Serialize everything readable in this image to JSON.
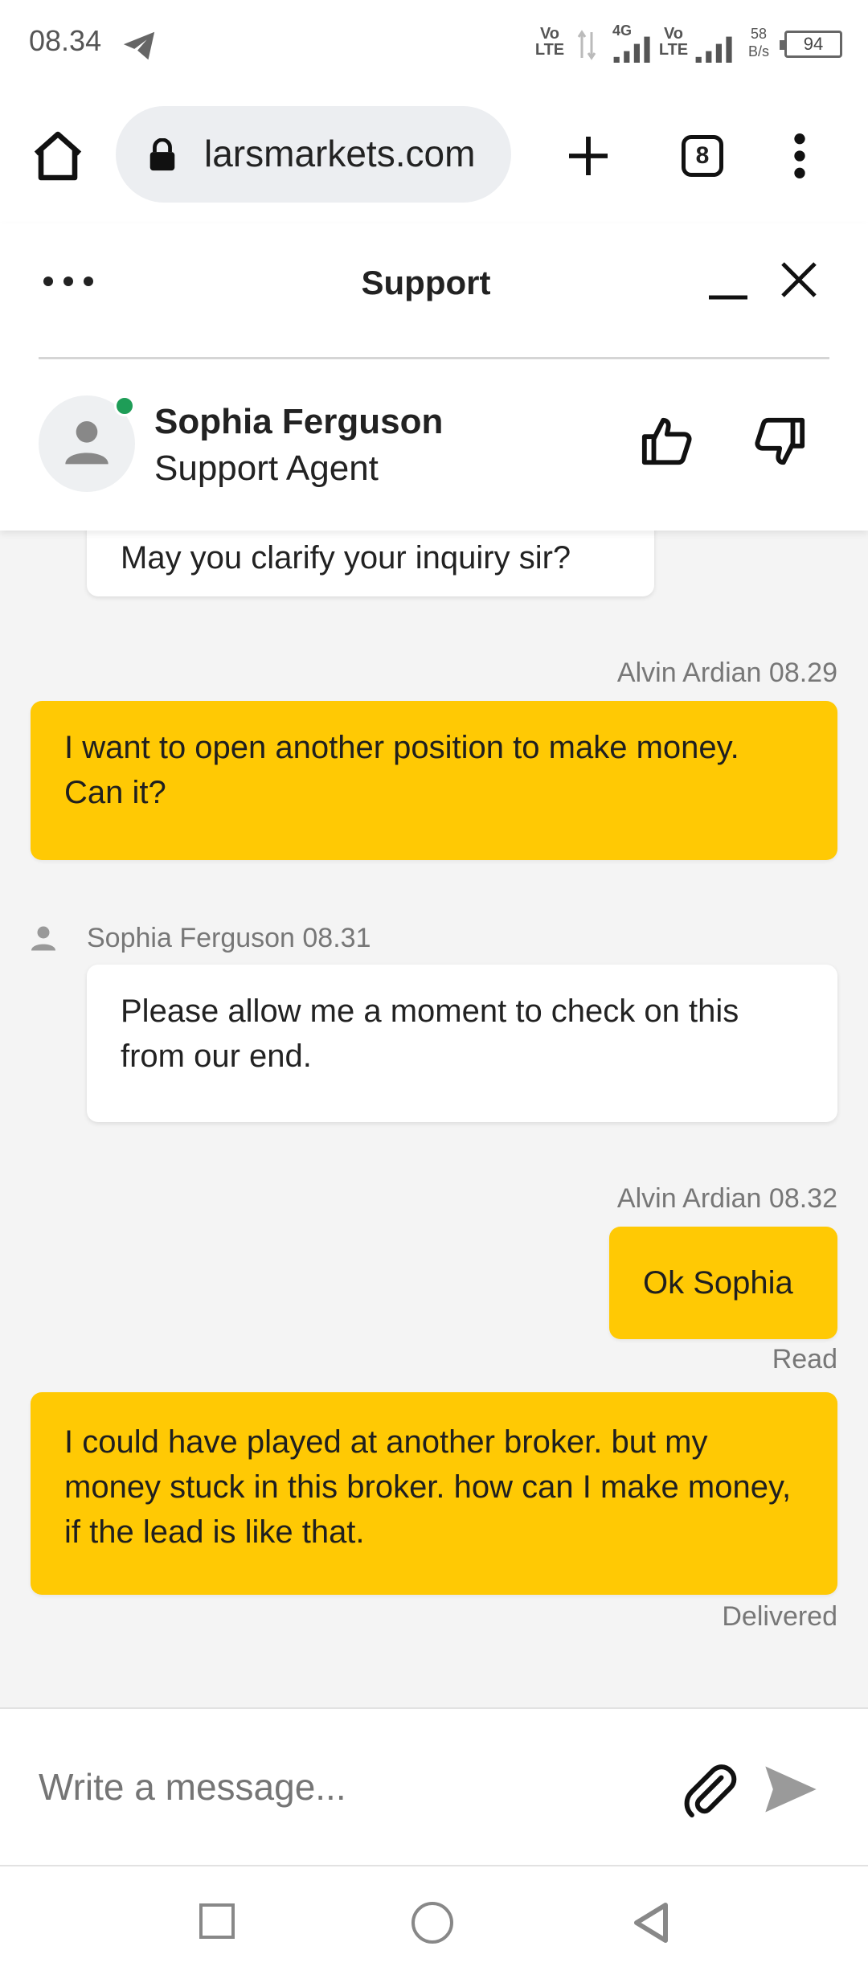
{
  "status_bar": {
    "time": "08.34",
    "volte_1": "Vo\nLTE",
    "network_type": "4G",
    "volte_2": "Vo\nLTE",
    "data_speed_value": "58",
    "data_speed_unit": "B/s",
    "battery": "94"
  },
  "browser": {
    "url": "larsmarkets.com",
    "tab_count": "8"
  },
  "chat": {
    "title": "Support",
    "agent": {
      "name": "Sophia Ferguson",
      "role": "Support Agent",
      "online": true
    },
    "messages": [
      {
        "direction": "incoming",
        "text": "May you clarify your inquiry sir?"
      },
      {
        "direction": "outgoing",
        "sender": "Alvin Ardian 08.29",
        "text": "I want to open another position to make money. Can it?"
      },
      {
        "direction": "incoming",
        "sender": "Sophia Ferguson 08.31",
        "text": "Please allow me a moment to check on this from our end."
      },
      {
        "direction": "outgoing",
        "sender": "Alvin Ardian 08.32",
        "text": "Ok Sophia",
        "status": "Read"
      },
      {
        "direction": "outgoing",
        "text": "I could have played at another broker. but my money stuck in this broker. how can I make money, if the lead is like that.",
        "status": "Delivered"
      }
    ],
    "composer_placeholder": "Write a message..."
  },
  "colors": {
    "outgoing_bubble": "#ffc904",
    "incoming_bubble": "#ffffff",
    "online_status": "#1e9d57",
    "background": "#f4f4f4"
  },
  "icons": [
    "telegram-icon",
    "signal-icon",
    "battery-icon",
    "home-icon",
    "lock-icon",
    "plus-icon",
    "tabs-icon",
    "overflow-menu-icon",
    "more-icon",
    "minimize-icon",
    "close-icon",
    "person-icon",
    "thumbs-up-icon",
    "thumbs-down-icon",
    "paperclip-icon",
    "send-icon",
    "recent-apps-icon",
    "home-nav-icon",
    "back-icon"
  ]
}
